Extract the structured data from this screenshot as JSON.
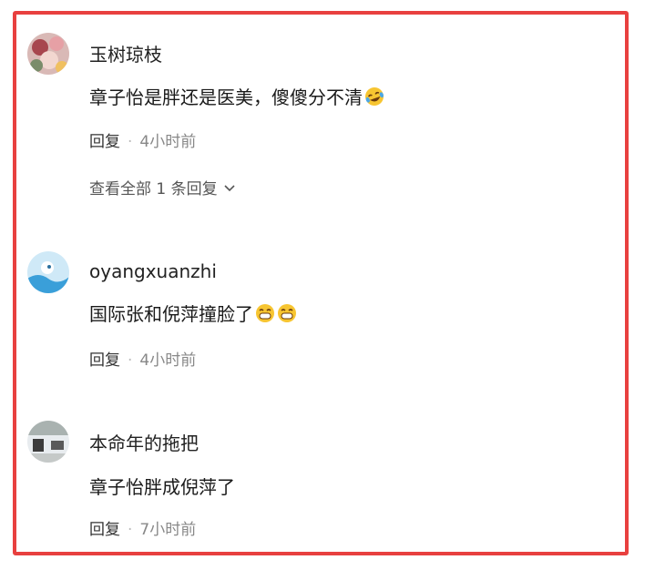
{
  "comments": [
    {
      "username": "玉树琼枝",
      "text": "章子怡是胖还是医美，傻傻分不清",
      "emoji": [
        "laugh-cry-emoji"
      ],
      "reply_label": "回复",
      "separator": "·",
      "time": "4小时前",
      "expand_label": "查看全部 1 条回复"
    },
    {
      "username": "oyangxuanzhi",
      "text": "国际张和倪萍撞脸了",
      "emoji": [
        "grin-emoji",
        "grin-emoji"
      ],
      "reply_label": "回复",
      "separator": "·",
      "time": "4小时前"
    },
    {
      "username": "本命年的拖把",
      "text": "章子怡胖成倪萍了",
      "reply_label": "回复",
      "separator": "·",
      "time": "7小时前"
    }
  ],
  "colors": {
    "frame_border": "#e8403f",
    "meta_gray": "#888888"
  }
}
